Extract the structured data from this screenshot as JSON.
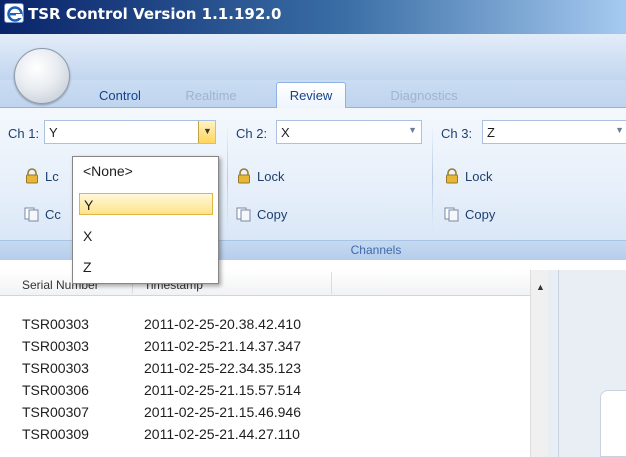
{
  "window": {
    "title": "TSR Control Version 1.1.192.0"
  },
  "tabs": [
    {
      "label": "Control",
      "state": "normal"
    },
    {
      "label": "Realtime",
      "state": "disabled"
    },
    {
      "label": "Review",
      "state": "active"
    },
    {
      "label": "Diagnostics",
      "state": "disabled"
    }
  ],
  "channels_group": {
    "label": "Channels",
    "channels": [
      {
        "label": "Ch 1:",
        "value": "Y",
        "lock_label": "Lock",
        "copy_label": "Copy"
      },
      {
        "label": "Ch 2:",
        "value": "X",
        "lock_label": "Lock",
        "copy_label": "Copy"
      },
      {
        "label": "Ch 3:",
        "value": "Z",
        "lock_label": "Lock",
        "copy_label": "Copy"
      }
    ],
    "ch1_partial": {
      "lock": "Lc",
      "copy": "Cc"
    }
  },
  "dropdown": {
    "options": [
      "<None>",
      "Y",
      "X",
      "Z"
    ],
    "selected": "Y"
  },
  "list": {
    "columns": [
      "Serial Number",
      "Timestamp"
    ],
    "rows": [
      [
        "TSR00303",
        "2011-02-25-20.38.42.410"
      ],
      [
        "TSR00303",
        "2011-02-25-21.14.37.347"
      ],
      [
        "TSR00303",
        "2011-02-25-22.34.35.123"
      ],
      [
        "TSR00306",
        "2011-02-25-21.15.57.514"
      ],
      [
        "TSR00307",
        "2011-02-25-21.15.46.946"
      ],
      [
        "TSR00309",
        "2011-02-25-21.44.27.110"
      ]
    ]
  },
  "icons": {
    "title": "ie-e-icon",
    "lock": "padlock-icon",
    "copy": "copy-icon",
    "combo_arrow": "chevron-down-icon"
  },
  "colors": {
    "title_gradient_start": "#0a246a",
    "ribbon_accent": "#15428b",
    "selected_item": "#ffe38a"
  }
}
